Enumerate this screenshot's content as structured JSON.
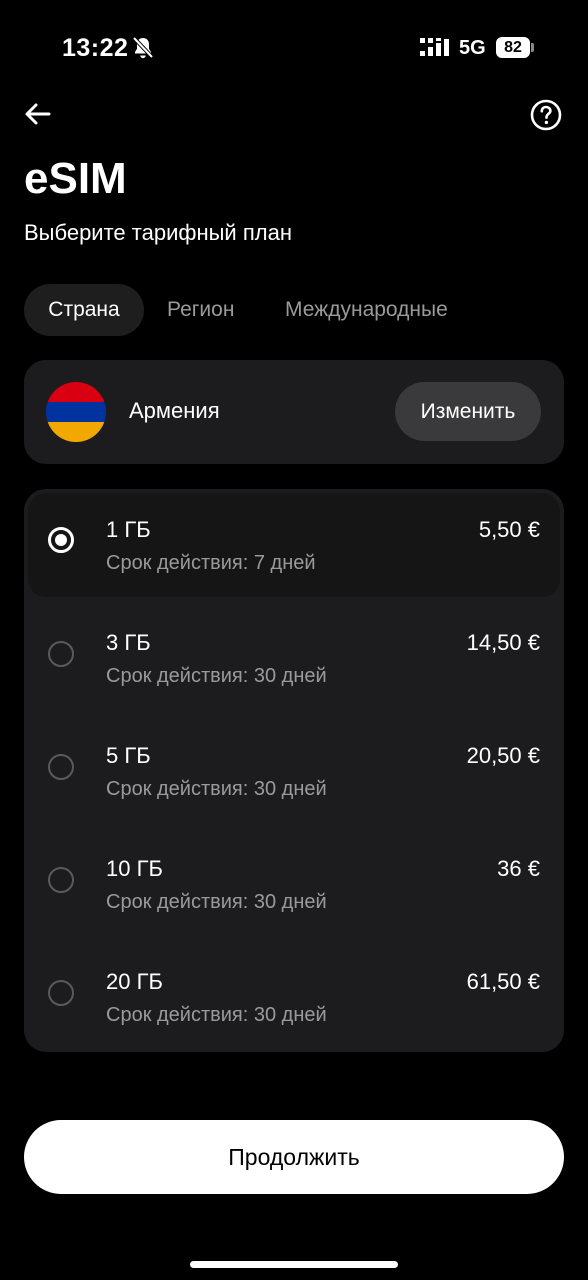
{
  "status_bar": {
    "time": "13:22",
    "network": "5G",
    "battery": "82"
  },
  "header": {
    "title": "eSIM",
    "subtitle": "Выберите тарифный план"
  },
  "tabs": [
    {
      "label": "Страна",
      "active": true
    },
    {
      "label": "Регион",
      "active": false
    },
    {
      "label": "Международные",
      "active": false
    }
  ],
  "country": {
    "name": "Армения",
    "change_label": "Изменить",
    "flag_colors": [
      "#D90012",
      "#0033A0",
      "#F2A800"
    ]
  },
  "plans": [
    {
      "size": "1 ГБ",
      "validity": "Срок действия: 7 дней",
      "price": "5,50 €",
      "selected": true
    },
    {
      "size": "3 ГБ",
      "validity": "Срок действия: 30 дней",
      "price": "14,50 €",
      "selected": false
    },
    {
      "size": "5 ГБ",
      "validity": "Срок действия: 30 дней",
      "price": "20,50 €",
      "selected": false
    },
    {
      "size": "10 ГБ",
      "validity": "Срок действия: 30 дней",
      "price": "36 €",
      "selected": false
    },
    {
      "size": "20 ГБ",
      "validity": "Срок действия: 30 дней",
      "price": "61,50 €",
      "selected": false
    }
  ],
  "continue_label": "Продолжить",
  "icons": {
    "back": "arrow-left-icon",
    "help": "question-circle-icon",
    "mute": "bell-off-icon",
    "signal": "signal-icon"
  }
}
